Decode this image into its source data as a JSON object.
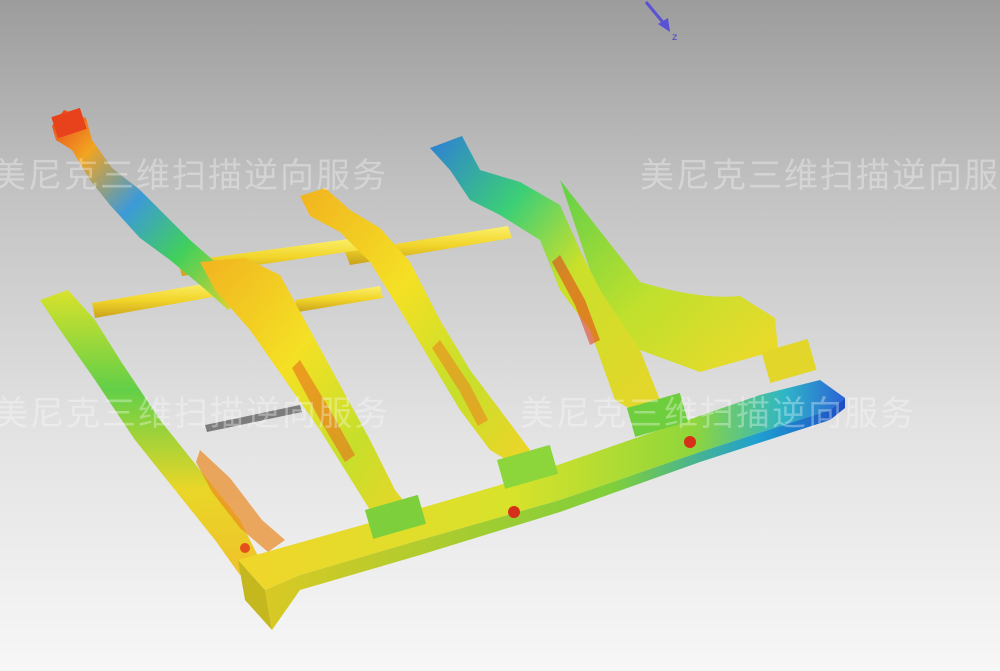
{
  "viewport": {
    "axis_label": "z",
    "watermark_text": "美尼克三维扫描逆向服务",
    "background_top": "#9c9c9c",
    "background_bottom": "#f7f7f7"
  },
  "deviation_colors": {
    "high": "#e03a1a",
    "upper": "#f2a21c",
    "mid_upper": "#f4e11f",
    "nominal": "#3fd34a",
    "lower": "#27b8c9",
    "low": "#1f5fd8"
  }
}
